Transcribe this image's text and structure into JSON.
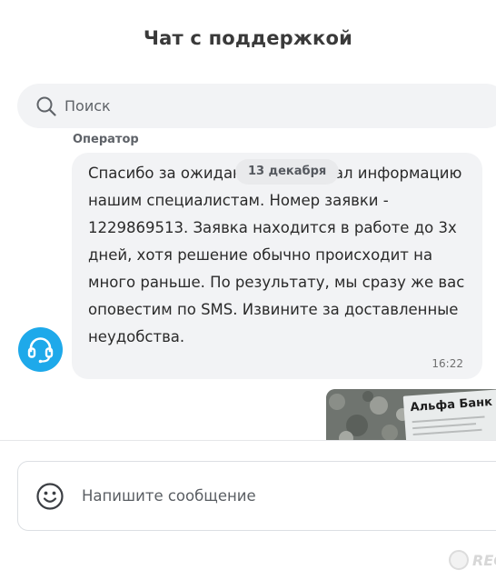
{
  "header": {
    "title": "Чат с поддержкой"
  },
  "search": {
    "placeholder": "Поиск",
    "icon": "search-icon"
  },
  "chat": {
    "date_separator": "13 декабря",
    "message": {
      "sender": "Оператор",
      "text": "Спасибо за ожидание. Я передал информацию нашим специалистам. Номер заявки - 1229869513. Заявка находится в работе до 3х дней, хотя решение обычно происходит на много раньше. По результату, мы сразу же вас оповестим по SMS. Извините за доставленные неудобства.",
      "time": "16:22",
      "avatar_icon": "headset-icon",
      "avatar_color": "#1ea9ea"
    },
    "attachment": {
      "photo_text": "Альфа Банк"
    }
  },
  "composer": {
    "placeholder": "Напишите сообщение",
    "emoji_icon": "smile-icon"
  },
  "watermark": {
    "text": "REC"
  }
}
